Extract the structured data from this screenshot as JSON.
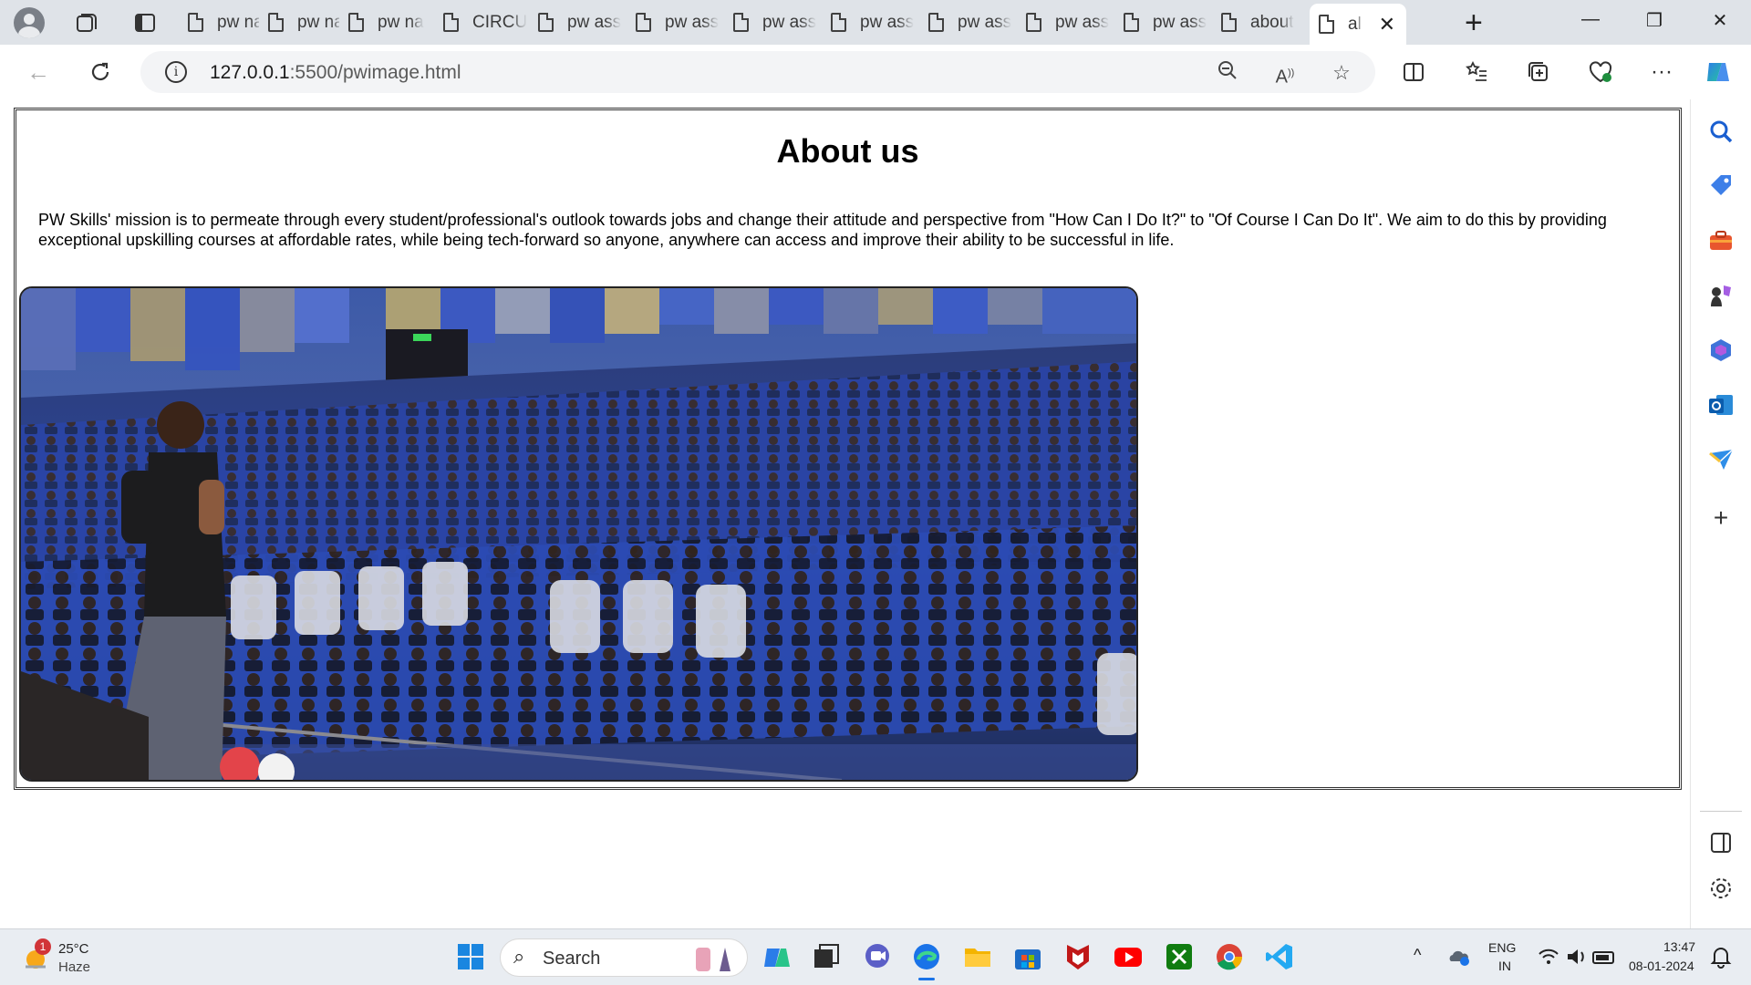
{
  "browser": {
    "tabs": [
      {
        "title": "pw na"
      },
      {
        "title": "pw na"
      },
      {
        "title": "pw na"
      },
      {
        "title": "CIRCU"
      },
      {
        "title": "pw ass"
      },
      {
        "title": "pw ass"
      },
      {
        "title": "pw ass"
      },
      {
        "title": "pw ass"
      },
      {
        "title": "pw ass"
      },
      {
        "title": "pw ass"
      },
      {
        "title": "pw ass"
      },
      {
        "title": "about"
      },
      {
        "title": "al",
        "active": true
      }
    ],
    "url_host": "127.0.0.1",
    "url_path": ":5500/pwimage.html"
  },
  "page": {
    "title": "About us",
    "paragraph": "PW Skills' mission is to permeate through every student/professional's outlook towards jobs and change their attitude and perspective from \"How Can I Do It?\" to \"Of Course I Can Do It\". We aim to do this by providing exceptional upskilling courses at affordable rates, while being tech-forward so anyone, anywhere can access and improve their ability to be successful in life."
  },
  "taskbar": {
    "weather_temp": "25°C",
    "weather_desc": "Haze",
    "weather_badge": "1",
    "search_label": "Search",
    "lang_1": "ENG",
    "lang_2": "IN",
    "time": "13:47",
    "date": "08-01-2024"
  },
  "colors": {
    "edge_blue": "#1a73e8",
    "tab_strip": "#dfe3e8"
  }
}
